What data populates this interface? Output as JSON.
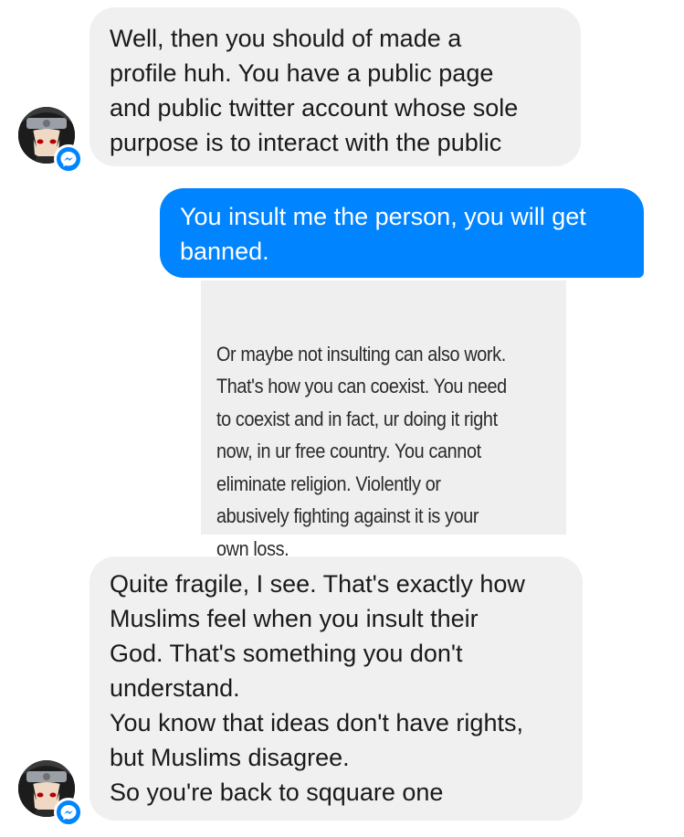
{
  "conversation": {
    "messages": [
      {
        "direction": "incoming",
        "text": "Well, then you should of made a\nprofile huh. You have a public page\nand public twitter account whose sole\npurpose is to interact with the public"
      },
      {
        "direction": "outgoing",
        "text": "You insult me the person, you will get\nbanned."
      },
      {
        "direction": "outgoing-image",
        "text": "Or maybe not insulting can also work.\nThat's how you can coexist. You need\nto coexist and in fact, ur doing it right\nnow, in ur free country. You cannot\neliminate religion. Violently or\nabusively fighting against it is your\nown loss."
      },
      {
        "direction": "incoming",
        "text": "Quite fragile, I see. That's exactly how\nMuslims feel when you insult their\nGod. That's something you don't\nunderstand.\nYou know that ideas don't have rights,\nbut Muslims disagree.\nSo you're back to sqquare one"
      }
    ]
  },
  "colors": {
    "incoming_bubble": "#f1f0f0",
    "outgoing_bubble": "#0084ff",
    "image_background": "#efefef",
    "messenger_badge": "#0084ff"
  },
  "icons": {
    "avatar": "anime-character-avatar",
    "badge": "messenger-icon"
  }
}
